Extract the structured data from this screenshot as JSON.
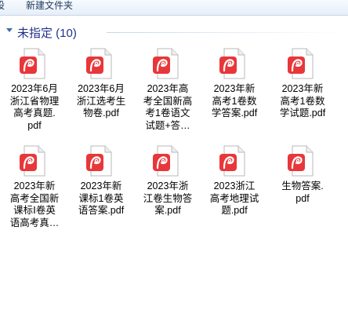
{
  "toolbar": {
    "partial_label": "设",
    "new_folder_label": "新建文件夹"
  },
  "group": {
    "title": "未指定 (10)"
  },
  "colors": {
    "pdf_icon_red": "#e8373a",
    "group_title": "#1e3287"
  },
  "files": [
    {
      "name": "2023年6月\n浙江省物理\n高考真题.\npdf",
      "icon": "pdf-icon"
    },
    {
      "name": "2023年6月\n浙江选考生\n物卷.pdf",
      "icon": "pdf-icon"
    },
    {
      "name": "2023年高\n考全国新高\n考1卷语文\n试题+答…",
      "icon": "pdf-icon"
    },
    {
      "name": "2023年新\n高考1卷数\n学答案.pdf",
      "icon": "pdf-icon"
    },
    {
      "name": "2023年新\n高考1卷数\n学试题.pdf",
      "icon": "pdf-icon"
    },
    {
      "name": "2023年新\n高考全国新\n课标Ⅰ卷英\n语高考真…",
      "icon": "pdf-icon"
    },
    {
      "name": "2023年新\n课标1卷英\n语答案.pdf",
      "icon": "pdf-icon"
    },
    {
      "name": "2023年浙\n江卷生物答\n案.pdf",
      "icon": "pdf-icon"
    },
    {
      "name": "2023浙江\n高考地理试\n题.pdf",
      "icon": "pdf-icon"
    },
    {
      "name": "生物答案.\npdf",
      "icon": "pdf-icon"
    }
  ]
}
